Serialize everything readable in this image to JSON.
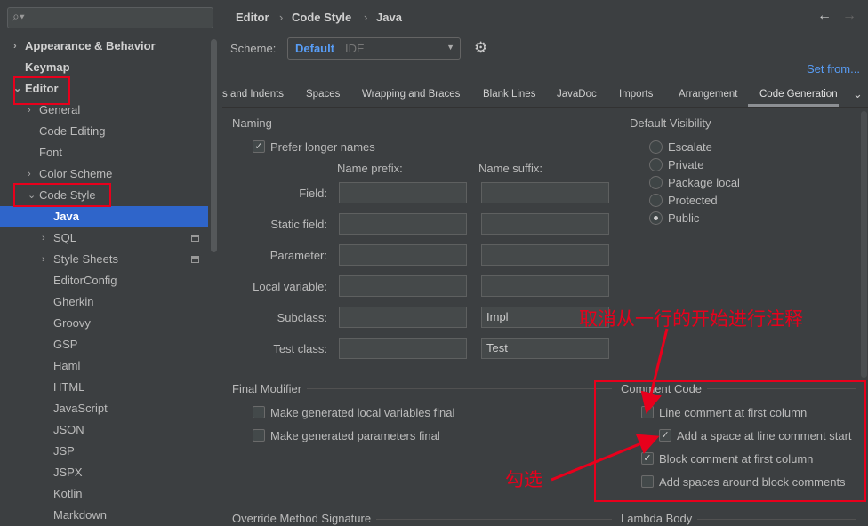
{
  "sidebar": {
    "search_placeholder": "",
    "items": [
      {
        "label": "Appearance & Behavior",
        "level": 0,
        "chevron": "right",
        "bold": true
      },
      {
        "label": "Keymap",
        "level": 0,
        "bold": true
      },
      {
        "label": "Editor",
        "level": 0,
        "chevron": "down",
        "bold": true
      },
      {
        "label": "General",
        "level": 1,
        "chevron": "right"
      },
      {
        "label": "Code Editing",
        "level": 1
      },
      {
        "label": "Font",
        "level": 1
      },
      {
        "label": "Color Scheme",
        "level": 1,
        "chevron": "right"
      },
      {
        "label": "Code Style",
        "level": 1,
        "chevron": "down"
      },
      {
        "label": "Java",
        "level": 2,
        "selected": true
      },
      {
        "label": "SQL",
        "level": 2,
        "chevron": "right",
        "badge": true
      },
      {
        "label": "Style Sheets",
        "level": 2,
        "chevron": "right",
        "badge": true
      },
      {
        "label": "EditorConfig",
        "level": 2
      },
      {
        "label": "Gherkin",
        "level": 2
      },
      {
        "label": "Groovy",
        "level": 2
      },
      {
        "label": "GSP",
        "level": 2
      },
      {
        "label": "Haml",
        "level": 2
      },
      {
        "label": "HTML",
        "level": 2
      },
      {
        "label": "JavaScript",
        "level": 2
      },
      {
        "label": "JSON",
        "level": 2
      },
      {
        "label": "JSP",
        "level": 2
      },
      {
        "label": "JSPX",
        "level": 2
      },
      {
        "label": "Kotlin",
        "level": 2
      },
      {
        "label": "Markdown",
        "level": 2
      }
    ]
  },
  "breadcrumb": [
    "Editor",
    "Code Style",
    "Java"
  ],
  "scheme": {
    "label": "Scheme:",
    "name": "Default",
    "type": "IDE"
  },
  "set_from": "Set from...",
  "tabs": [
    "s and Indents",
    "Spaces",
    "Wrapping and Braces",
    "Blank Lines",
    "JavaDoc",
    "Imports",
    "Arrangement",
    "Code Generation"
  ],
  "active_tab": "Code Generation",
  "naming": {
    "title": "Naming",
    "prefer_longer": {
      "label": "Prefer longer names",
      "checked": true
    },
    "prefix_header": "Name prefix:",
    "suffix_header": "Name suffix:",
    "rows": [
      {
        "label": "Field:",
        "prefix": "",
        "suffix": ""
      },
      {
        "label": "Static field:",
        "prefix": "",
        "suffix": ""
      },
      {
        "label": "Parameter:",
        "prefix": "",
        "suffix": ""
      },
      {
        "label": "Local variable:",
        "prefix": "",
        "suffix": ""
      },
      {
        "label": "Subclass:",
        "prefix": "",
        "suffix": "Impl"
      },
      {
        "label": "Test class:",
        "prefix": "",
        "suffix": "Test"
      }
    ]
  },
  "visibility": {
    "title": "Default Visibility",
    "options": [
      "Escalate",
      "Private",
      "Package local",
      "Protected",
      "Public"
    ],
    "selected": "Public"
  },
  "final_modifier": {
    "title": "Final Modifier",
    "options": [
      {
        "label": "Make generated local variables final",
        "checked": false
      },
      {
        "label": "Make generated parameters final",
        "checked": false
      }
    ]
  },
  "comment_code": {
    "title": "Comment Code",
    "options": [
      {
        "label": "Line comment at first column",
        "checked": false,
        "indent": false
      },
      {
        "label": "Add a space at line comment start",
        "checked": true,
        "indent": true
      },
      {
        "label": "Block comment at first column",
        "checked": true,
        "indent": false
      },
      {
        "label": "Add spaces around block comments",
        "checked": false,
        "indent": false
      }
    ]
  },
  "override_title": "Override Method Signature",
  "lambda_title": "Lambda Body",
  "annotations": {
    "top": "取消从一行的开始进行注释",
    "bottom": "勾选",
    "color": "#e8001c"
  }
}
